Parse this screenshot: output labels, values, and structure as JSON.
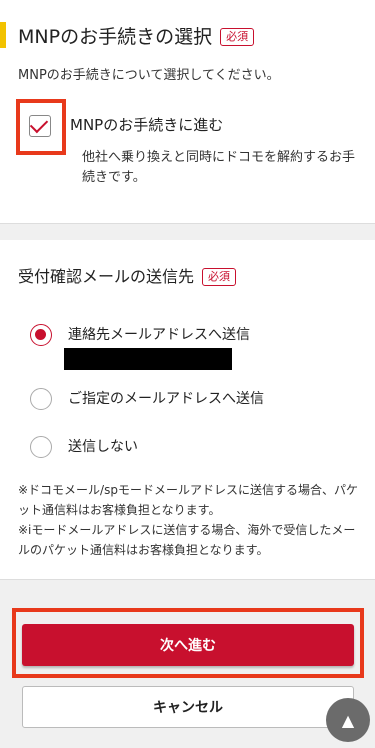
{
  "mnp_section": {
    "title": "MNPのお手続きの選択",
    "required_badge": "必須",
    "instruction": "MNPのお手続きについて選択してください。",
    "checkbox_label": "MNPのお手続きに進む",
    "checkbox_checked": true,
    "checkbox_description": "他社へ乗り換えと同時にドコモを解約するお手続きです。"
  },
  "email_section": {
    "title": "受付確認メールの送信先",
    "required_badge": "必須",
    "options": [
      {
        "label": "連絡先メールアドレスへ送信",
        "selected": true
      },
      {
        "label": "ご指定のメールアドレスへ送信",
        "selected": false
      },
      {
        "label": "送信しない",
        "selected": false
      }
    ],
    "footnote": "※ドコモメール/spモードメールアドレスに送信する場合、パケット通信料はお客様負担となります。\n※iモードメールアドレスに送信する場合、海外で受信したメールのパケット通信料はお客様負担となります。"
  },
  "buttons": {
    "next": "次へ進む",
    "cancel": "キャンセル",
    "scroll_top_icon": "arrow-up-icon"
  },
  "colors": {
    "accent": "#c8102e",
    "highlight": "#e8391b",
    "title_bar": "#f2c200"
  }
}
